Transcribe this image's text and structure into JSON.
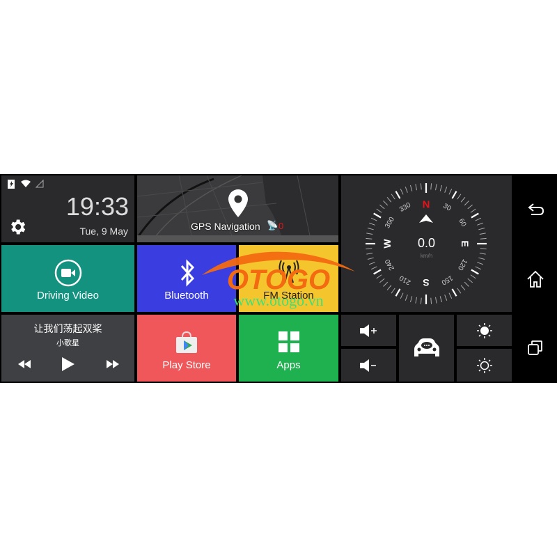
{
  "status": {
    "icons": [
      "battery-charging-icon",
      "wifi-icon",
      "signal-icon"
    ]
  },
  "clock": {
    "time": "19:33",
    "date": "Tue, 9 May"
  },
  "gps": {
    "label": "GPS Navigation",
    "satellites": "0"
  },
  "compass": {
    "speed": "0.0",
    "unit": "km/h",
    "N": "N",
    "E": "E",
    "S": "S",
    "W": "W",
    "degrees": [
      "30",
      "60",
      "120",
      "150",
      "210",
      "240",
      "300",
      "330"
    ]
  },
  "tiles": {
    "driving_video": "Driving Video",
    "bluetooth": "Bluetooth",
    "fm": "FM Station",
    "play_store": "Play Store",
    "apps": "Apps"
  },
  "music": {
    "title": "让我们荡起双桨",
    "artist": "小歌星"
  },
  "colors": {
    "teal": "#12927f",
    "blue": "#3a3ee0",
    "yellow": "#f5c52e",
    "red": "#f0575a",
    "green": "#1fb14f",
    "dark": "#2a292c",
    "north": "#e5141b"
  },
  "watermark": {
    "logo": "OTOGO",
    "url": "www.otogo.vn"
  }
}
